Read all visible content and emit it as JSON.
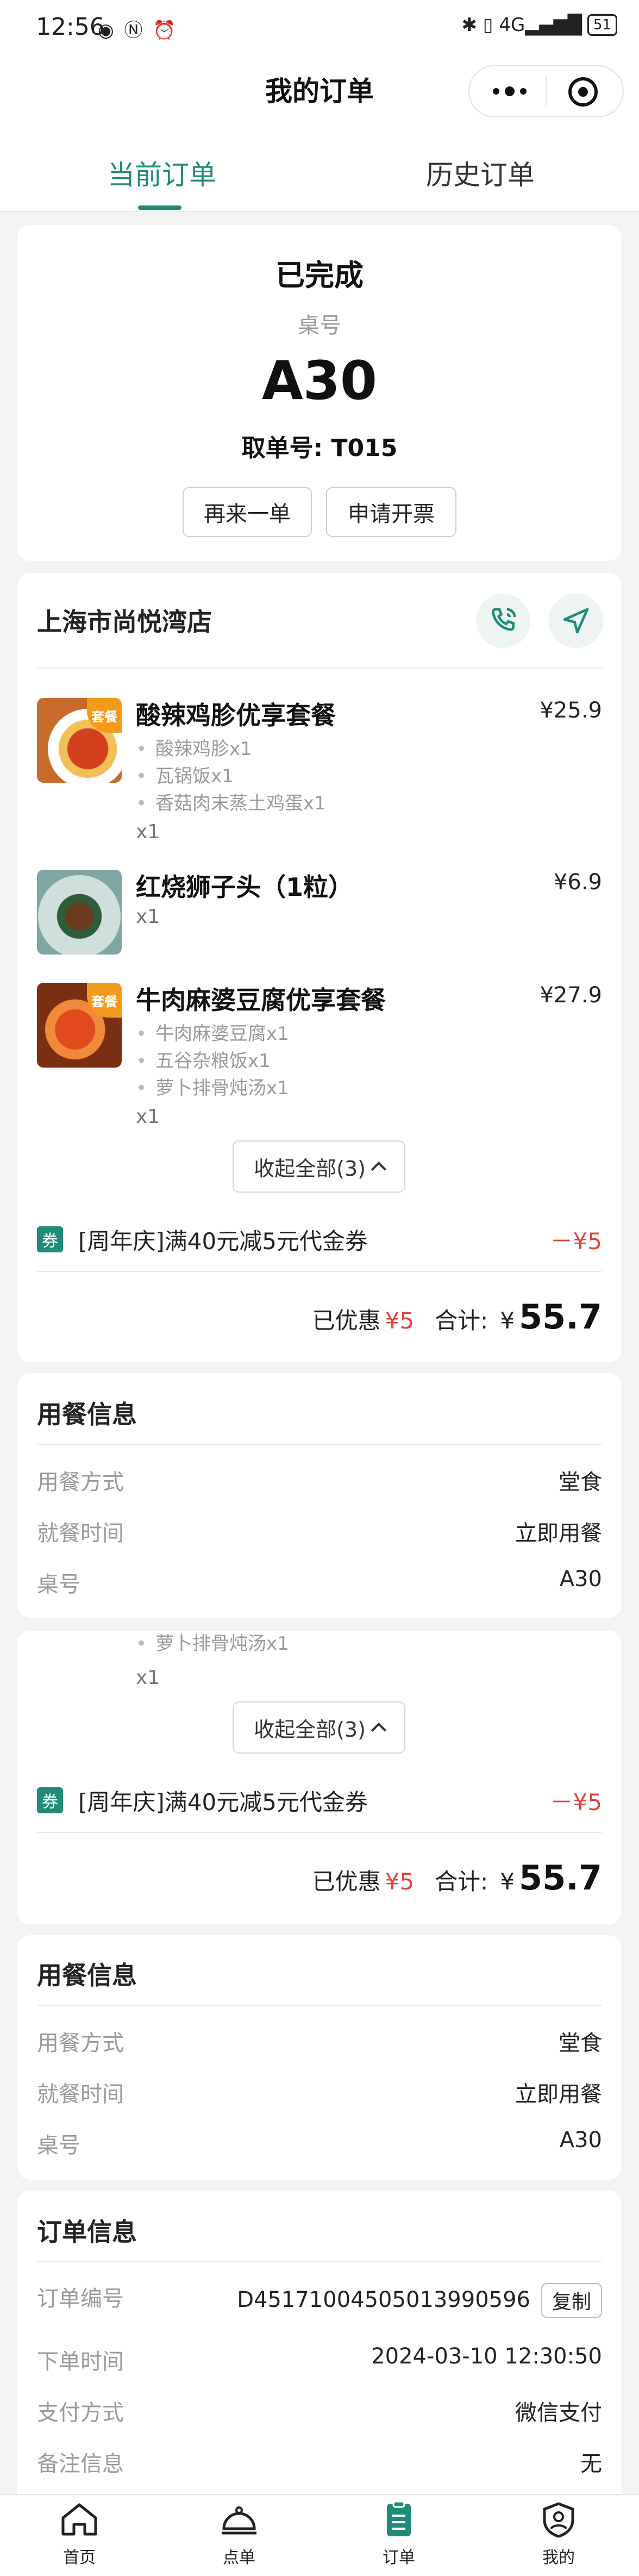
{
  "status_bar": {
    "time": "12:56",
    "left_icons": "◉ Ⓝ ⏰",
    "right_icons": "✱ ▯ 4G▂▄▆█",
    "battery": "51"
  },
  "nav": {
    "title": "我的订单"
  },
  "tabs": [
    {
      "label": "当前订单"
    },
    {
      "label": "历史订单"
    }
  ],
  "order_status": {
    "status": "已完成",
    "table_label": "桌号",
    "table_number": "A30",
    "pickup_label": "取单号: T015",
    "reorder_button": "再来一单",
    "invoice_button": "申请开票"
  },
  "store": {
    "name": "上海市尚悦湾店"
  },
  "items": [
    {
      "name": "酸辣鸡胗优享套餐",
      "price": "¥25.9",
      "badge": "套餐",
      "subitems": [
        "酸辣鸡胗x1",
        "瓦锅饭x1",
        "香菇肉末蒸土鸡蛋x1"
      ],
      "qty": "x1"
    },
    {
      "name": "红烧狮子头（1粒）",
      "price": "¥6.9",
      "qty": "x1"
    },
    {
      "name": "牛肉麻婆豆腐优享套餐",
      "price": "¥27.9",
      "badge": "套餐",
      "subitems": [
        "牛肉麻婆豆腐x1",
        "五谷杂粮饭x1",
        "萝卜排骨炖汤x1"
      ],
      "qty": "x1"
    }
  ],
  "collapse_label": "收起全部(3)",
  "coupon": {
    "icon": "券",
    "text": "[周年庆]满40元减5元代金券",
    "amount": "－¥5"
  },
  "summary": {
    "discount_label": "已优惠",
    "discount": "¥5",
    "total_label": "合计:",
    "currency": "¥",
    "total": "55.7"
  },
  "dining_info": {
    "title": "用餐信息",
    "rows": [
      {
        "label": "用餐方式",
        "value": "堂食"
      },
      {
        "label": "就餐时间",
        "value": "立即用餐"
      },
      {
        "label": "桌号",
        "value": "A30"
      }
    ]
  },
  "partial": {
    "subitem": "萝卜排骨炖汤x1",
    "qty": "x1"
  },
  "order_info": {
    "title": "订单信息",
    "rows": [
      {
        "label": "订单编号",
        "value": "D45171004505013990596"
      },
      {
        "label": "下单时间",
        "value": "2024-03-10 12:30:50"
      },
      {
        "label": "支付方式",
        "value": "微信支付"
      },
      {
        "label": "备注信息",
        "value": "无"
      }
    ],
    "copy_button": "复制"
  },
  "bottom_tabs": [
    {
      "label": "首页"
    },
    {
      "label": "点单"
    },
    {
      "label": "订单"
    },
    {
      "label": "我的"
    }
  ],
  "colors": {
    "accent": "#1f8c78",
    "price_red": "#e0443c",
    "badge_orange": "#f39a1c"
  }
}
